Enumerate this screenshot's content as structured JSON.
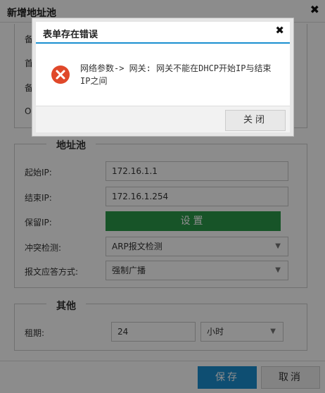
{
  "window": {
    "title": "新增地址池",
    "close_glyph": "✖"
  },
  "top_section": {
    "side_letters": [
      "备",
      "首",
      "备",
      "O"
    ]
  },
  "pool_group": {
    "legend": "地址池",
    "start_ip_label": "起始IP:",
    "start_ip_value": "172.16.1.1",
    "end_ip_label": "结束IP:",
    "end_ip_value": "172.16.1.254",
    "reserved_ip_label": "保留IP:",
    "reserved_ip_button": "设置",
    "conflict_label": "冲突检测:",
    "conflict_value": "ARP报文检测",
    "reply_label": "报文应答方式:",
    "reply_value": "强制广播"
  },
  "other_group": {
    "legend": "其他",
    "lease_label": "租期:",
    "lease_value": "24",
    "lease_unit": "小时"
  },
  "footer": {
    "save_label": "保存",
    "cancel_label": "取消"
  },
  "dialog": {
    "title": "表单存在错误",
    "close_glyph": "✖",
    "icon": "error-x-icon",
    "message": "网络参数-> 网关: 网关不能在DHCP开始IP与结束IP之间",
    "close_button": "关闭"
  },
  "colors": {
    "accent_blue": "#1a8fd0",
    "green": "#2b9a4a",
    "error_red": "#e0482a"
  }
}
